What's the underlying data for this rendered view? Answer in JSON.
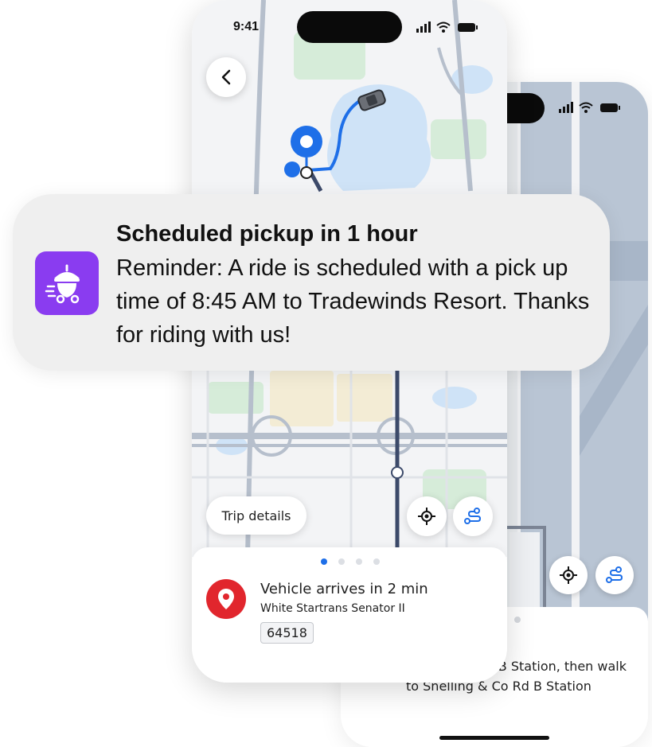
{
  "front_phone": {
    "status_bar": {
      "time": "9:41"
    },
    "map": {
      "back_button_icon": "chevron-left-icon"
    },
    "trip_details_label": "Trip details",
    "fab_icons": [
      "locate-icon",
      "route-icon"
    ],
    "sheet": {
      "page_count": 4,
      "active_page": 1,
      "pin_icon": "map-pin-icon",
      "arrival_title": "Vehicle arrives in 2 min",
      "vehicle_name": "White Startrans Senator II",
      "vehicle_number": "64518"
    }
  },
  "back_phone": {
    "fab_icons": [
      "locate-icon",
      "route-icon"
    ],
    "trip_description": "…ing & Co Rd B Station, then walk to Snelling & Co Rd B Station"
  },
  "notification": {
    "app_icon": "acorn-cart-icon",
    "title": "Scheduled pickup in 1 hour",
    "body": "Reminder: A ride is scheduled with a pick up time of 8:45 AM to Tradewinds Resort. Thanks for riding with us!"
  },
  "colors": {
    "accent_blue": "#1e6fe8",
    "route_blue": "#1e6fe8",
    "pin_red": "#e1262d",
    "app_purple": "#8a3cf0",
    "map_water": "#cfe3f7",
    "map_park": "#d6ecd9",
    "map_road": "#b6bfcc",
    "transit_line": "#3c4a6a"
  }
}
